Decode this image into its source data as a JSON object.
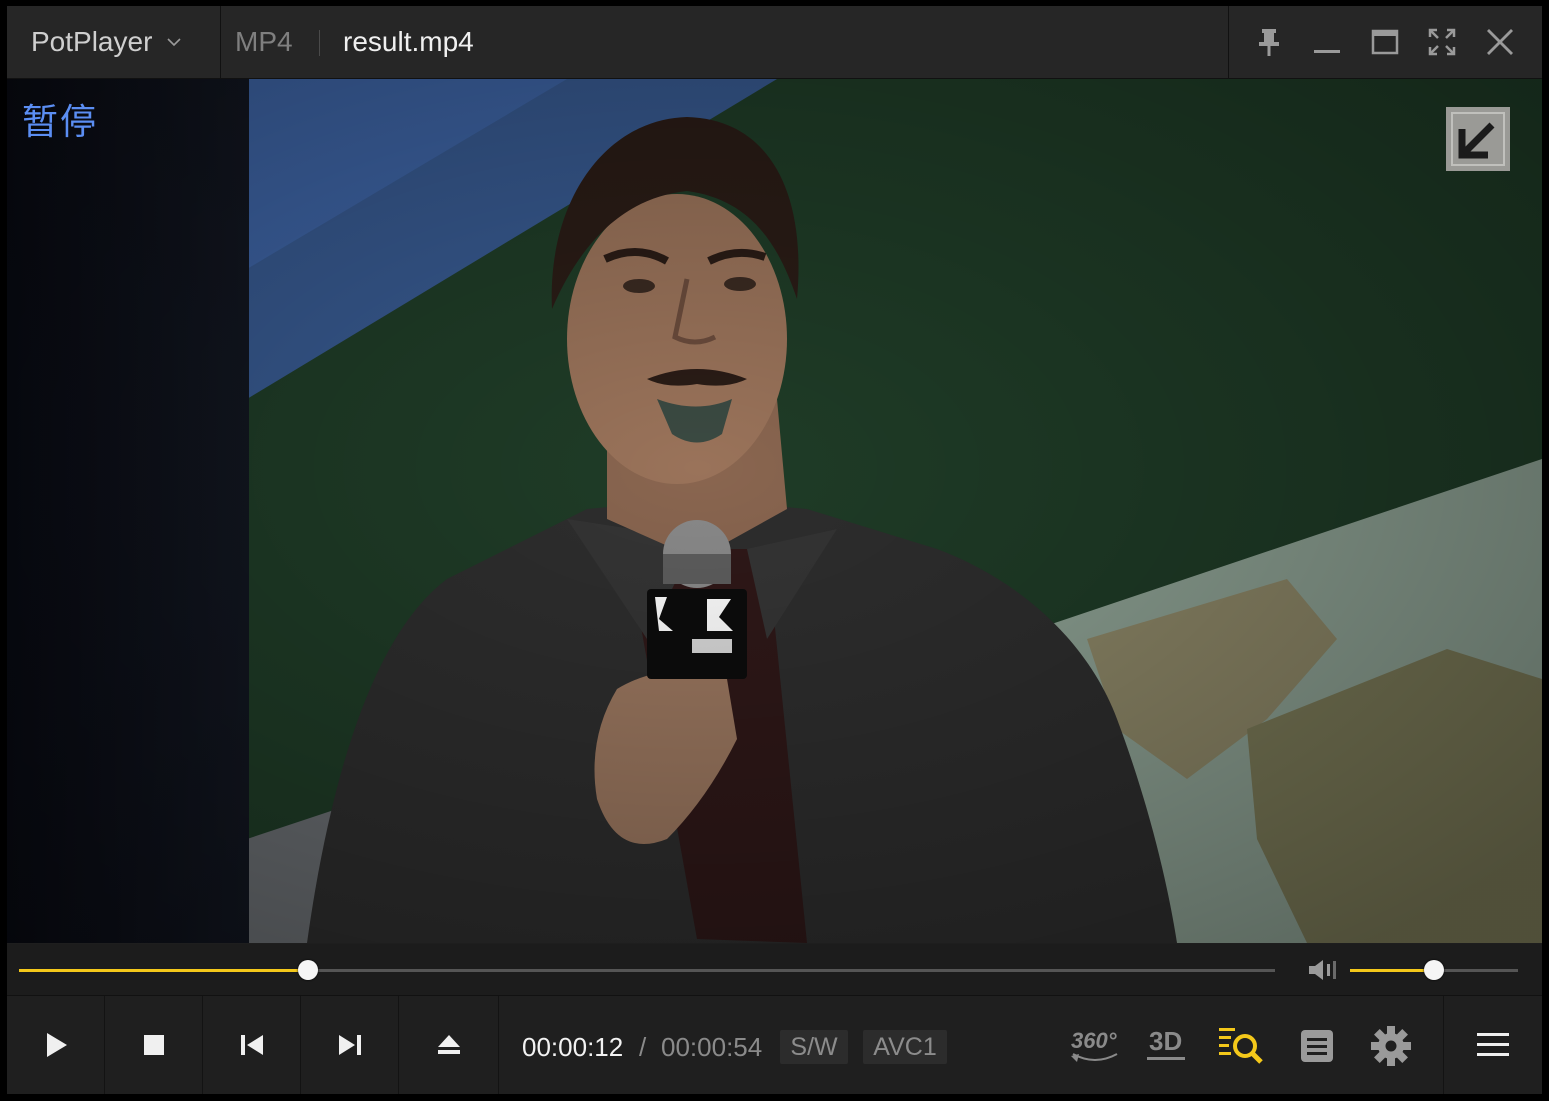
{
  "app": {
    "name": "PotPlayer",
    "format": "MP4",
    "file_name": "result.mp4"
  },
  "overlay": {
    "status_text": "暂停"
  },
  "playback": {
    "current_time": "00:00:12",
    "separator": "/",
    "total_time": "00:00:54",
    "progress_fraction": 0.23,
    "volume_fraction": 0.5
  },
  "badges": {
    "decoder": "S/W",
    "codec": "AVC1"
  },
  "icons": {
    "vr": "360°",
    "stereo": "3D"
  },
  "colors": {
    "accent": "#f4c81a",
    "status_text": "#5b8ef3",
    "background": "#1e1e1e"
  }
}
